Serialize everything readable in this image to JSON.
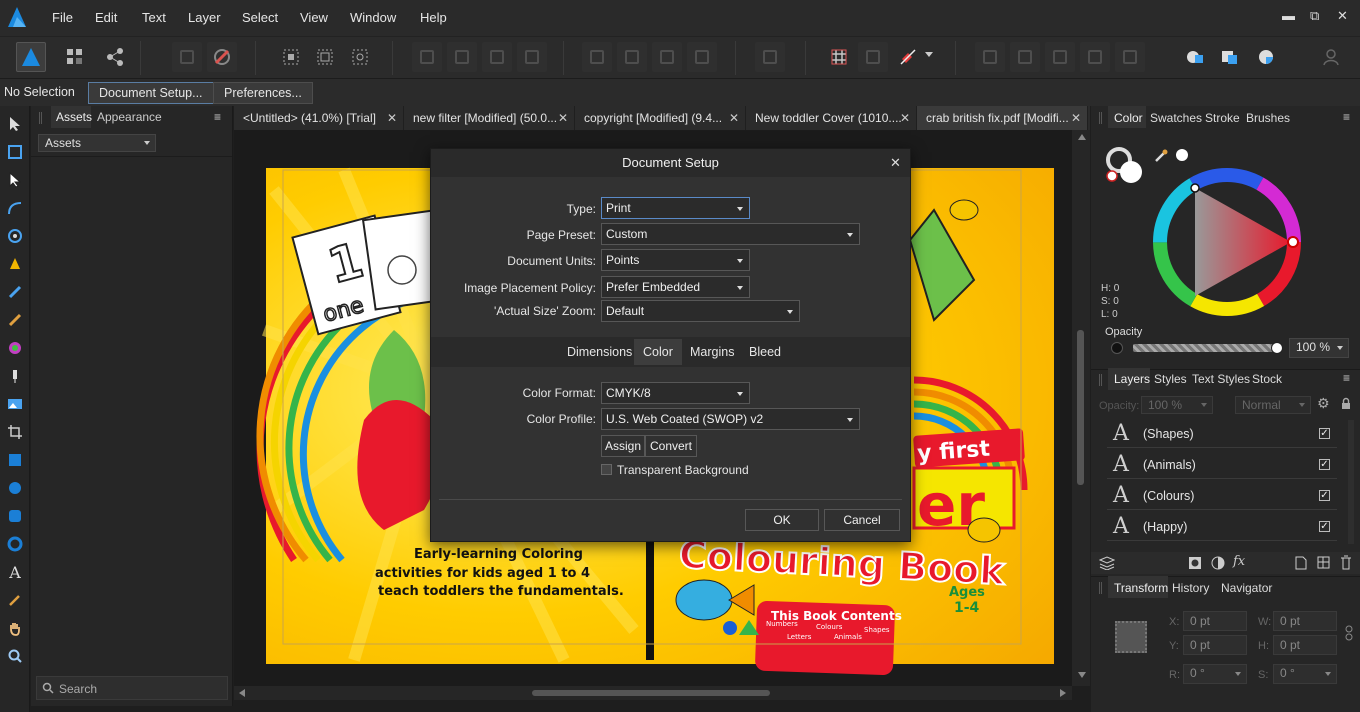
{
  "menu": {
    "items": [
      "File",
      "Edit",
      "Text",
      "Layer",
      "Select",
      "View",
      "Window",
      "Help"
    ]
  },
  "window_controls": {
    "minimize": "▬",
    "restore": "⧉",
    "close": "✕"
  },
  "context_bar": {
    "selection": "No Selection",
    "document_setup": "Document Setup...",
    "preferences": "Preferences..."
  },
  "left_panel": {
    "tabs": [
      "Assets",
      "Appearance"
    ],
    "assets_dropdown": "Assets",
    "search_placeholder": "Search"
  },
  "doc_tabs": [
    {
      "label": "<Untitled> (41.0%) [Trial]"
    },
    {
      "label": "new filter [Modified] (50.0..."
    },
    {
      "label": "copyright [Modified] (9.4..."
    },
    {
      "label": "New toddler Cover (1010...."
    },
    {
      "label": "crab british fix.pdf [Modifi...",
      "active": true
    }
  ],
  "tab_close": "✕",
  "artwork": {
    "line1": "Early-learning Coloring",
    "line2": "activities for kids aged 1 to 4",
    "line3": "teach toddlers the fundamentals.",
    "card_word": "one",
    "card_number": "1",
    "my_first": "y first",
    "title_partial": "er",
    "title": "Colouring Book",
    "ages": "Ages",
    "ages_range": "1-4",
    "contents_title": "This Book Contents",
    "contents_items": [
      "Numbers",
      "Colours",
      "Shapes",
      "Letters",
      "Animals"
    ]
  },
  "dialog": {
    "title": "Document Setup",
    "close": "✕",
    "type_label": "Type:",
    "type_value": "Print",
    "preset_label": "Page Preset:",
    "preset_value": "Custom",
    "units_label": "Document Units:",
    "units_value": "Points",
    "placement_label": "Image Placement Policy:",
    "placement_value": "Prefer Embedded",
    "zoom_label": "'Actual Size' Zoom:",
    "zoom_value": "Default",
    "tabs": [
      "Dimensions",
      "Color",
      "Margins",
      "Bleed"
    ],
    "active_tab": "Color",
    "format_label": "Color Format:",
    "format_value": "CMYK/8",
    "profile_label": "Color Profile:",
    "profile_value": "U.S. Web Coated (SWOP) v2",
    "assign": "Assign",
    "convert": "Convert",
    "transparent_bg": "Transparent Background",
    "ok": "OK",
    "cancel": "Cancel"
  },
  "color_panel": {
    "tabs": [
      "Color",
      "Swatches",
      "Stroke",
      "Brushes"
    ],
    "h": "H: 0",
    "s": "S: 0",
    "l": "L: 0",
    "opacity_label": "Opacity",
    "opacity_value": "100 %"
  },
  "layers_panel": {
    "tabs": [
      "Layers",
      "Styles",
      "Text Styles",
      "Stock"
    ],
    "opacity_label": "Opacity:",
    "opacity_value": "100 %",
    "blend_mode": "Normal",
    "layers": [
      {
        "name": "(Shapes)"
      },
      {
        "name": "(Animals)"
      },
      {
        "name": "(Colours)"
      },
      {
        "name": "(Happy)"
      }
    ]
  },
  "transform_panel": {
    "tabs": [
      "Transform",
      "History",
      "Navigator"
    ],
    "x_label": "X:",
    "x": "0 pt",
    "w_label": "W:",
    "w": "0 pt",
    "y_label": "Y:",
    "y": "0 pt",
    "h_label": "H:",
    "h": "0 pt",
    "r_label": "R:",
    "r": "0 °",
    "s_label": "S:",
    "s": "0 °"
  },
  "colors": {
    "accent": "#1473e6",
    "wheel_red": "#e8192c",
    "artwork_yellow": "#f5c400"
  }
}
